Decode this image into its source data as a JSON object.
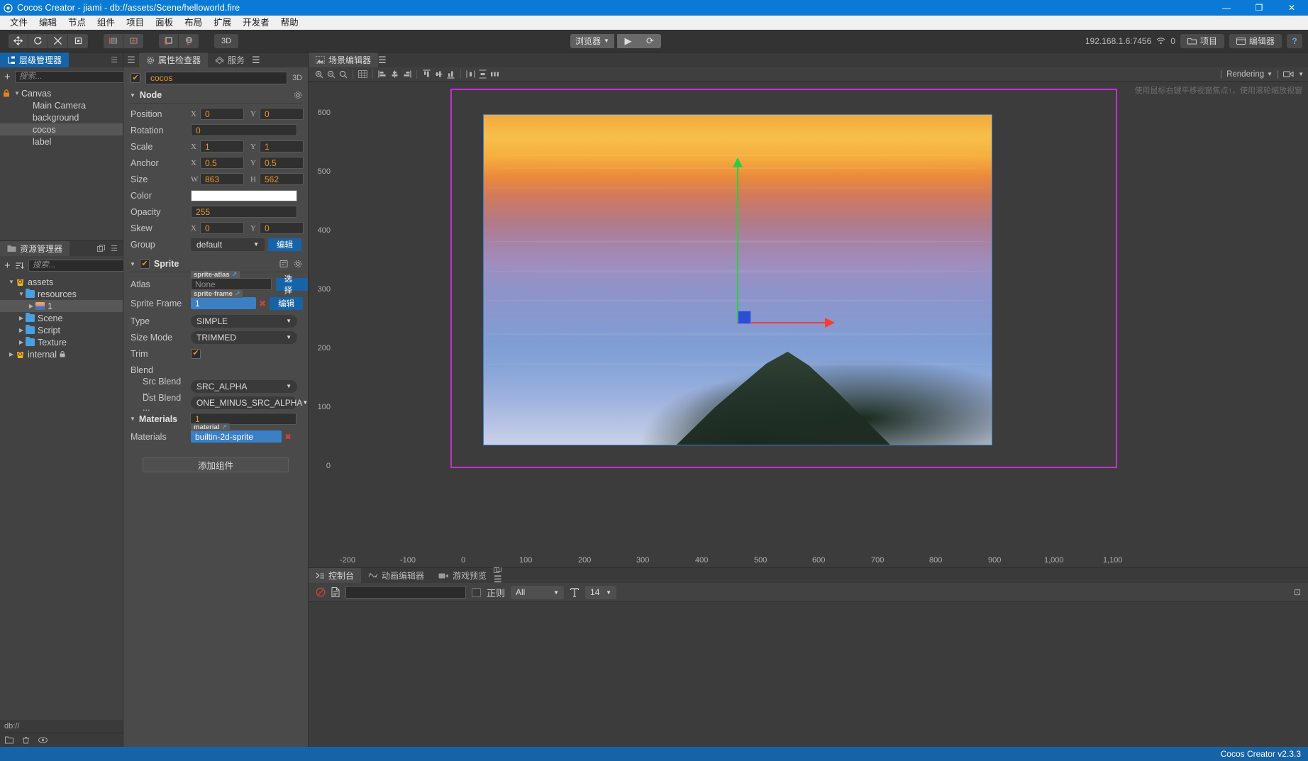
{
  "window": {
    "title": "Cocos Creator - jiami - db://assets/Scene/helloworld.fire",
    "minimize": "—",
    "maximize": "❐",
    "close": "✕"
  },
  "menubar": [
    "文件",
    "编辑",
    "节点",
    "组件",
    "项目",
    "面板",
    "布局",
    "扩展",
    "开发者",
    "帮助"
  ],
  "toolbar": {
    "transform_tools": [
      "move-tool",
      "rotate-tool",
      "scale-tool",
      "rect-tool"
    ],
    "align_tools": [
      "align-left-tool",
      "align-center-tool"
    ],
    "pivot_tools": [
      "pivot-tool",
      "coord-tool"
    ],
    "mode_3d_label": "3D",
    "browser_label": "浏览器",
    "play_label": "▶",
    "refresh_label": "⟳",
    "ip_address": "192.168.1.6:7456",
    "device_count": "0",
    "project_button": "项目",
    "editor_button": "编辑器",
    "help_button": "?"
  },
  "hierarchy": {
    "tab_label": "层级管理器",
    "add_label": "+",
    "search_placeholder": "搜索...",
    "nodes": [
      {
        "label": "Canvas",
        "depth": 0,
        "locked": true,
        "expanded": true,
        "selected": false
      },
      {
        "label": "Main Camera",
        "depth": 1,
        "locked": false,
        "expanded": false,
        "selected": false
      },
      {
        "label": "background",
        "depth": 1,
        "locked": false,
        "expanded": false,
        "selected": false
      },
      {
        "label": "cocos",
        "depth": 1,
        "locked": false,
        "expanded": false,
        "selected": true
      },
      {
        "label": "label",
        "depth": 1,
        "locked": false,
        "expanded": false,
        "selected": false
      }
    ]
  },
  "assets": {
    "tab_label": "资源管理器",
    "add_label": "+",
    "search_placeholder": "搜索...",
    "path_label": "db://",
    "tree": [
      {
        "label": "assets",
        "depth": 0,
        "type": "root",
        "expanded": true,
        "selected": false
      },
      {
        "label": "resources",
        "depth": 1,
        "type": "folder",
        "expanded": true,
        "selected": false
      },
      {
        "label": "1",
        "depth": 2,
        "type": "image",
        "expanded": false,
        "selected": true
      },
      {
        "label": "Scene",
        "depth": 1,
        "type": "folder",
        "expanded": false,
        "selected": false
      },
      {
        "label": "Script",
        "depth": 1,
        "type": "folder",
        "expanded": false,
        "selected": false
      },
      {
        "label": "Texture",
        "depth": 1,
        "type": "folder",
        "expanded": false,
        "selected": false
      },
      {
        "label": "internal",
        "depth": 0,
        "type": "root-locked",
        "expanded": false,
        "selected": false
      }
    ]
  },
  "inspector": {
    "tabs": [
      {
        "label": "属性检查器",
        "active": true,
        "icon": "gear-icon"
      },
      {
        "label": "服务",
        "active": false,
        "icon": "service-icon"
      }
    ],
    "node_name": "cocos",
    "node_enabled": true,
    "badge_3d": "3D",
    "node_section": {
      "title": "Node",
      "rows": [
        {
          "label": "Position",
          "kind": "xy",
          "x_axis": "X",
          "x": "0",
          "y_axis": "Y",
          "y": "0"
        },
        {
          "label": "Rotation",
          "kind": "single",
          "value": "0"
        },
        {
          "label": "Scale",
          "kind": "xy",
          "x_axis": "X",
          "x": "1",
          "y_axis": "Y",
          "y": "1"
        },
        {
          "label": "Anchor",
          "kind": "xy",
          "x_axis": "X",
          "x": "0.5",
          "y_axis": "Y",
          "y": "0.5"
        },
        {
          "label": "Size",
          "kind": "xy",
          "x_axis": "W",
          "x": "863",
          "y_axis": "H",
          "y": "562"
        },
        {
          "label": "Color",
          "kind": "color",
          "value": "#ffffff"
        },
        {
          "label": "Opacity",
          "kind": "single",
          "value": "255"
        },
        {
          "label": "Skew",
          "kind": "xy",
          "x_axis": "X",
          "x": "0",
          "y_axis": "Y",
          "y": "0"
        },
        {
          "label": "Group",
          "kind": "select-edit",
          "value": "default",
          "button": "编辑"
        }
      ]
    },
    "sprite_section": {
      "title": "Sprite",
      "enabled": true,
      "atlas": {
        "label": "Atlas",
        "tag": "sprite-atlas",
        "value": "None",
        "filled": false,
        "button": "选择"
      },
      "sprite_frame": {
        "label": "Sprite Frame",
        "tag": "sprite-frame",
        "value": "1",
        "filled": true,
        "button": "编辑"
      },
      "type": {
        "label": "Type",
        "value": "SIMPLE"
      },
      "size_mode": {
        "label": "Size Mode",
        "value": "TRIMMED"
      },
      "trim": {
        "label": "Trim",
        "checked": true
      },
      "blend": {
        "label": "Blend"
      },
      "src_blend": {
        "label": "Src Blend ...",
        "value": "SRC_ALPHA"
      },
      "dst_blend": {
        "label": "Dst Blend ...",
        "value": "ONE_MINUS_SRC_ALPHA"
      }
    },
    "materials_section": {
      "title": "Materials",
      "count": "1",
      "row_label": "Materials",
      "tag": "material",
      "value": "builtin-2d-sprite"
    },
    "add_component_label": "添加组件"
  },
  "scene": {
    "tab_label": "场景编辑器",
    "rendering_label": "Rendering",
    "hint": "使用鼠标右键平移视窗焦点↑，使用滚轮缩放视窗",
    "ruler_x": [
      "-200",
      "-100",
      "0",
      "100",
      "200",
      "300",
      "400",
      "500",
      "600",
      "700",
      "800",
      "900",
      "1,000",
      "1,100"
    ],
    "ruler_y": [
      "600",
      "500",
      "400",
      "300",
      "200",
      "100",
      "0"
    ],
    "frame_color": "#c72fd0",
    "image_border_color": "#3b7fc4",
    "gizmo": {
      "y_axis_color": "#2ecc40",
      "x_axis_color": "#ff3b30",
      "center_color": "#2b4fd0"
    }
  },
  "console": {
    "tabs": [
      {
        "label": "控制台",
        "active": true,
        "icon": "console-icon"
      },
      {
        "label": "动画编辑器",
        "active": false,
        "icon": "animation-icon"
      },
      {
        "label": "游戏预览",
        "active": false,
        "icon": "camera-icon"
      }
    ],
    "clear_icon": "clear-icon",
    "file_icon": "file-icon",
    "filter_value": "",
    "regex_label": "正则",
    "regex_checked": false,
    "level_filter": "All",
    "font_size_icon": "text-size-icon",
    "font_size": "14"
  },
  "statusbar": {
    "version": "Cocos Creator v2.3.3"
  }
}
